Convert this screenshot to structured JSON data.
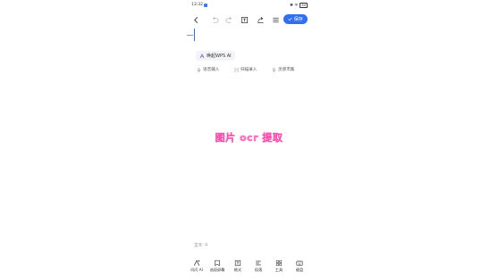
{
  "status_bar": {
    "time": "13:32",
    "right_text": "✱ ᯤ",
    "battery": "84"
  },
  "toolbar": {
    "save_label": "保存"
  },
  "editor": {
    "ai_chip_label": "唤起WPS AI",
    "quick_actions": [
      "语音输入",
      "扫描录入",
      "灵感市集"
    ],
    "word_count": "全文: 0"
  },
  "overlay": {
    "text": "图片 ocr 提取"
  },
  "bottom_bar": {
    "items": [
      "问问 AI",
      "选段屏幕",
      "格式",
      "段落",
      "工具",
      "键盘"
    ]
  },
  "colors": {
    "accent": "#2f6ff2",
    "overlay_text": "#ff7bc3"
  }
}
